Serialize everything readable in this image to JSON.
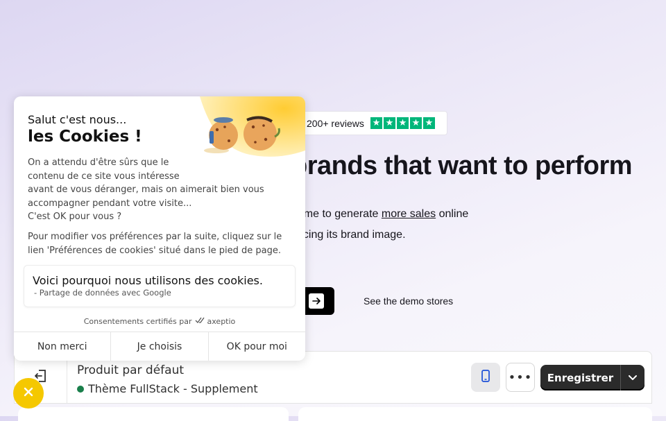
{
  "hero": {
    "reviews_text": "200+ reviews",
    "stars": [
      "★",
      "★",
      "★",
      "★",
      "★"
    ],
    "title": "brands that want to perform",
    "line1_before": "heme to generate ",
    "line1_link": "more sales",
    "line1_after": " online",
    "line2": "rificing its brand image.",
    "demo_link": "See the demo stores"
  },
  "editor": {
    "product_title": "Produit par défaut",
    "theme_name": "Thème FullStack - Supplement",
    "theme_status_color": "#1a7f4b",
    "more_label": "•••",
    "save_label": "Enregistrer",
    "icons": [
      "exit-icon",
      "mobile-device-icon",
      "more-icon",
      "chevron-down-icon",
      "arrow-right-icon"
    ]
  },
  "cookie": {
    "greeting": "Salut c'est nous...",
    "title": "les Cookies !",
    "body_lines": [
      "On a attendu d'être sûrs que le",
      "contenu de ce site vous intéresse",
      "avant de vous déranger, mais on aimerait bien vous",
      "accompagner pendant votre visite...",
      "C'est OK pour vous ?"
    ],
    "note": "Pour modifier vos préférences par la suite, cliquez sur le lien 'Préférences de cookies' situé dans le pied de page.",
    "why_title": "Voici pourquoi nous utilisons des cookies.",
    "why_sub": "- Partage de données avec Google",
    "certified_text": "Consentements certifiés par",
    "certified_brand": "axeptio",
    "buttons": {
      "reject": "Non merci",
      "choose": "Je choisis",
      "accept": "OK pour moi"
    },
    "accent_color": "#f5c800"
  }
}
